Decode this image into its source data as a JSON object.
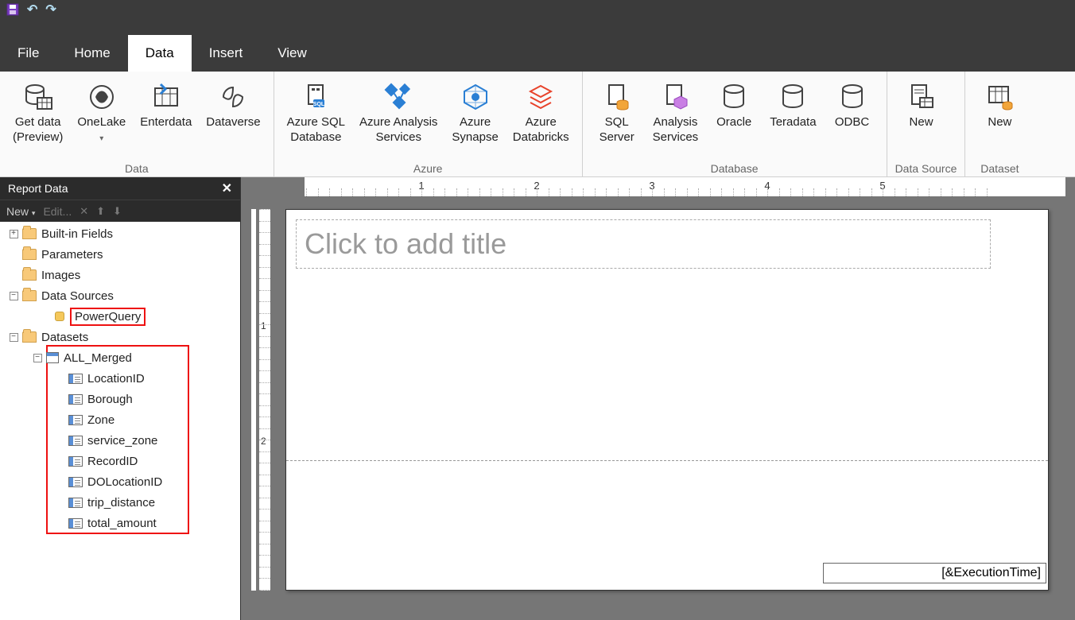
{
  "qat": {
    "save_title": "Save",
    "undo_title": "Undo",
    "redo_title": "Redo"
  },
  "menus": {
    "file": "File",
    "home": "Home",
    "data": "Data",
    "insert": "Insert",
    "view": "View"
  },
  "ribbon": {
    "groups": {
      "data": {
        "label": "Data",
        "getdata_l1": "Get data",
        "getdata_l2": "(Preview)",
        "onelake": "OneLake",
        "enterdata": "Enterdata",
        "dataverse": "Dataverse"
      },
      "azure": {
        "label": "Azure",
        "sqldb_l1": "Azure SQL",
        "sqldb_l2": "Database",
        "analysis_l1": "Azure Analysis",
        "analysis_l2": "Services",
        "synapse_l1": "Azure",
        "synapse_l2": "Synapse",
        "databricks_l1": "Azure",
        "databricks_l2": "Databricks"
      },
      "database": {
        "label": "Database",
        "sqlserver_l1": "SQL",
        "sqlserver_l2": "Server",
        "asvc_l1": "Analysis",
        "asvc_l2": "Services",
        "oracle": "Oracle",
        "teradata": "Teradata",
        "odbc": "ODBC"
      },
      "datasource": {
        "label": "Data Source",
        "new": "New"
      },
      "dataset": {
        "label": "Dataset",
        "new": "New"
      }
    }
  },
  "panel": {
    "title": "Report Data",
    "tools": {
      "new": "New",
      "edit": "Edit...",
      "delete_title": "Delete",
      "up_title": "Move Up",
      "down_title": "Move Down"
    },
    "tree": {
      "builtin": "Built-in Fields",
      "parameters": "Parameters",
      "images": "Images",
      "datasources": "Data Sources",
      "ds_powerquery": "PowerQuery",
      "datasets": "Datasets",
      "dataset_allmerged": "ALL_Merged",
      "fields": {
        "locationid": "LocationID",
        "borough": "Borough",
        "zone": "Zone",
        "service_zone": "service_zone",
        "recordid": "RecordID",
        "dolocationid": "DOLocationID",
        "trip_distance": "trip_distance",
        "total_amount": "total_amount"
      }
    }
  },
  "canvas": {
    "title_placeholder": "Click to add title",
    "exec_time": "[&ExecutionTime]",
    "ruler": {
      "n1": "1",
      "n2": "2",
      "n3": "3",
      "n4": "4",
      "n5": "5"
    }
  }
}
